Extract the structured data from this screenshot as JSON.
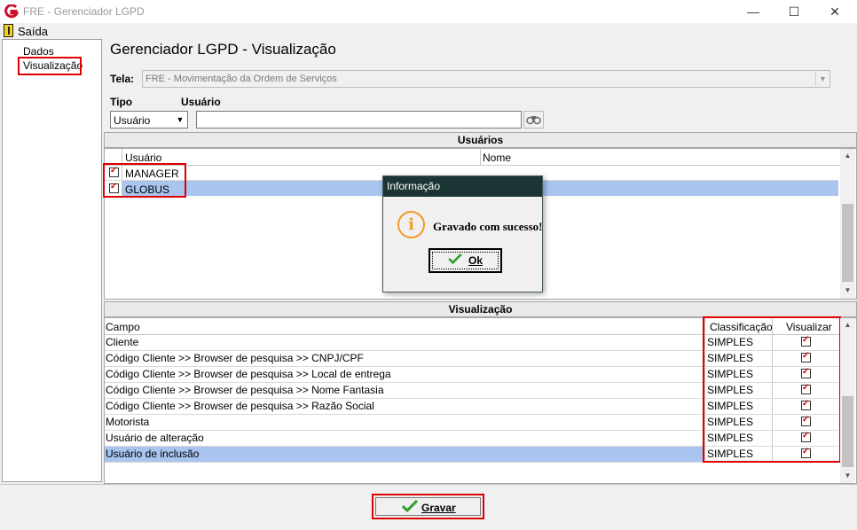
{
  "window": {
    "title": "FRE - Gerenciador LGPD",
    "minimize_glyph": "—",
    "maximize_glyph": "☐",
    "close_glyph": "✕"
  },
  "menu": {
    "saida_label": "Saída"
  },
  "tree": {
    "items": [
      {
        "label": "Dados"
      },
      {
        "label": "Visualização"
      }
    ]
  },
  "header": {
    "title": "Gerenciador LGPD - Visualização",
    "tela_label": "Tela:",
    "tela_value": "FRE - Movimentação da Ordem de Serviços",
    "tipo_label": "Tipo",
    "usuario_label": "Usuário",
    "tipo_value": "Usuário",
    "usuario_value": ""
  },
  "usuarios_panel": {
    "title": "Usuários",
    "columns": [
      "Usuário",
      "Nome"
    ],
    "rows": [
      {
        "usuario": "MANAGER",
        "nome": "",
        "checked": true
      },
      {
        "usuario": "GLOBUS",
        "nome": "",
        "checked": true,
        "selected": true
      }
    ]
  },
  "visualizacao_panel": {
    "title": "Visualização",
    "columns": [
      "Campo",
      "Classificação",
      "Visualizar"
    ],
    "rows": [
      {
        "campo": "Cliente",
        "classificacao": "SIMPLES",
        "visualizar": true
      },
      {
        "campo": "Código Cliente >> Browser de pesquisa >> CNPJ/CPF",
        "classificacao": "SIMPLES",
        "visualizar": true
      },
      {
        "campo": "Código Cliente >> Browser de pesquisa >> Local de entrega",
        "classificacao": "SIMPLES",
        "visualizar": true
      },
      {
        "campo": "Código Cliente >> Browser de pesquisa >> Nome Fantasia",
        "classificacao": "SIMPLES",
        "visualizar": true
      },
      {
        "campo": "Código Cliente >> Browser de pesquisa >> Razão Social",
        "classificacao": "SIMPLES",
        "visualizar": true
      },
      {
        "campo": "Motorista",
        "classificacao": "SIMPLES",
        "visualizar": true
      },
      {
        "campo": "Usuário de alteração",
        "classificacao": "SIMPLES",
        "visualizar": true
      },
      {
        "campo": "Usuário de inclusão",
        "classificacao": "SIMPLES",
        "visualizar": true,
        "selected": true
      }
    ]
  },
  "dialog": {
    "title": "Informação",
    "message": "Gravado com sucesso!",
    "ok_label": "Ok",
    "icon": "info-icon",
    "icon_glyph": "i"
  },
  "footer": {
    "gravar_label": "Gravar"
  },
  "colors": {
    "highlight": "#e00000",
    "selection": "#a8c4ef",
    "dialog_titlebar": "#1b3535",
    "check": "#2e9e2e",
    "info": "#f39a28"
  }
}
